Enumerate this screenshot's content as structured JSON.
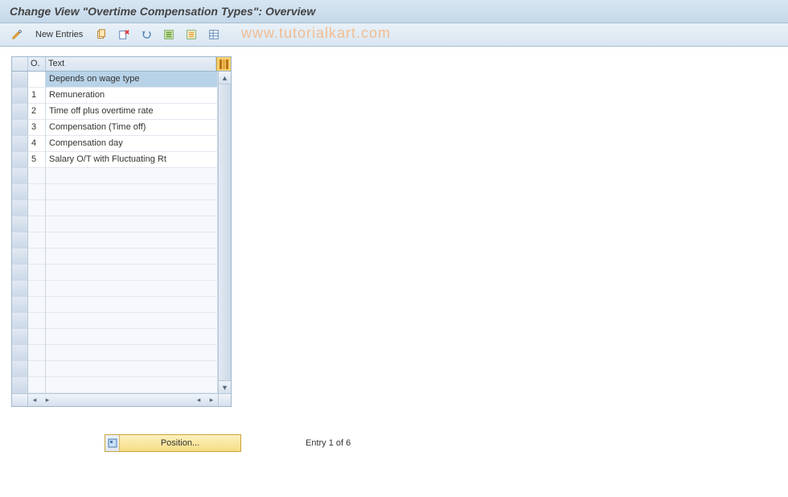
{
  "header": {
    "title": "Change View \"Overtime Compensation Types\": Overview"
  },
  "toolbar": {
    "newEntries": "New Entries"
  },
  "watermark": "www.tutorialkart.com",
  "table": {
    "colO": "O.",
    "colText": "Text",
    "rows": [
      {
        "o": "",
        "text": "Depends on wage type",
        "selected": true
      },
      {
        "o": "1",
        "text": "Remuneration"
      },
      {
        "o": "2",
        "text": "Time off plus overtime rate"
      },
      {
        "o": "3",
        "text": "Compensation (Time off)"
      },
      {
        "o": "4",
        "text": "Compensation day"
      },
      {
        "o": "5",
        "text": "Salary O/T with Fluctuating Rt"
      }
    ],
    "emptyRowCount": 14
  },
  "footer": {
    "positionLabel": "Position...",
    "entryStatus": "Entry 1 of 6"
  }
}
